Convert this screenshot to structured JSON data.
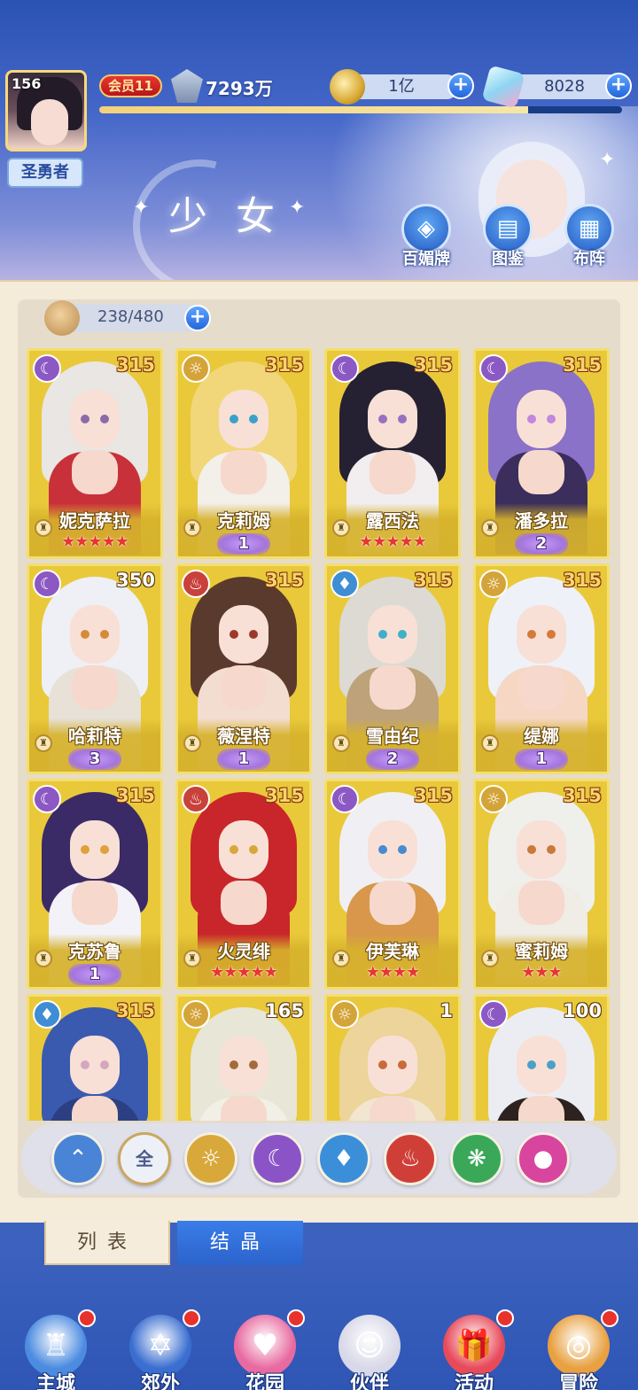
{
  "header": {
    "player_level": "156",
    "player_title": "圣勇者",
    "vip": "会员11",
    "power": "7293万",
    "exp_progress": 0.82,
    "gold": "1亿",
    "gems": "8028",
    "page_title": "少女",
    "buttons": [
      {
        "label": "百媚牌",
        "icon": "card-deck-icon"
      },
      {
        "label": "图鉴",
        "icon": "book-icon"
      },
      {
        "label": "布阵",
        "icon": "formation-grid-icon"
      }
    ]
  },
  "roster": {
    "capacity": "238/480",
    "cards": [
      {
        "name": "妮克萨拉",
        "level": "315",
        "element": "moon",
        "stars": 5,
        "awaken": null
      },
      {
        "name": "克莉姆",
        "level": "315",
        "element": "sun",
        "stars": 0,
        "awaken": "1"
      },
      {
        "name": "露西法",
        "level": "315",
        "element": "moon",
        "stars": 5,
        "awaken": null
      },
      {
        "name": "潘多拉",
        "level": "315",
        "element": "moon",
        "stars": 0,
        "awaken": "2"
      },
      {
        "name": "哈莉特",
        "level": "350",
        "element": "moon",
        "stars": 0,
        "awaken": "3"
      },
      {
        "name": "薇涅特",
        "level": "315",
        "element": "fire",
        "stars": 0,
        "awaken": "1"
      },
      {
        "name": "雪由纪",
        "level": "315",
        "element": "water",
        "stars": 0,
        "awaken": "2"
      },
      {
        "name": "缇娜",
        "level": "315",
        "element": "sun",
        "stars": 0,
        "awaken": "1"
      },
      {
        "name": "克苏鲁",
        "level": "315",
        "element": "moon",
        "stars": 0,
        "awaken": "1"
      },
      {
        "name": "火灵绯",
        "level": "315",
        "element": "fire",
        "stars": 5,
        "awaken": null
      },
      {
        "name": "伊芙琳",
        "level": "315",
        "element": "moon",
        "stars": 4,
        "awaken": null
      },
      {
        "name": "蜜莉姆",
        "level": "315",
        "element": "sun",
        "stars": 3,
        "awaken": null
      },
      {
        "name": "",
        "level": "315",
        "element": "water",
        "stars": 0,
        "awaken": null
      },
      {
        "name": "",
        "level": "165",
        "element": "sun",
        "stars": 0,
        "awaken": null
      },
      {
        "name": "",
        "level": "1",
        "element": "sun",
        "stars": 0,
        "awaken": null
      },
      {
        "name": "",
        "level": "100",
        "element": "moon",
        "stars": 0,
        "awaken": null
      }
    ]
  },
  "filters": [
    {
      "label": "",
      "icon": "sort-up-icon",
      "color": "#4a84d6"
    },
    {
      "label": "全",
      "icon": "all-icon",
      "color": "#eef0f8"
    },
    {
      "label": "",
      "icon": "sun-element-icon",
      "color": "#d8a83a"
    },
    {
      "label": "",
      "icon": "moon-element-icon",
      "color": "#8a54c6"
    },
    {
      "label": "",
      "icon": "water-element-icon",
      "color": "#3b8fd8"
    },
    {
      "label": "",
      "icon": "fire-element-icon",
      "color": "#cf3f38"
    },
    {
      "label": "",
      "icon": "wind-element-icon",
      "color": "#3aa858"
    },
    {
      "label": "",
      "icon": "heart-element-icon",
      "color": "#d8459e"
    }
  ],
  "tabs": {
    "list": "列表",
    "crystal": "结晶"
  },
  "nav": [
    {
      "label": "主城",
      "icon": "castle-icon",
      "badge": true
    },
    {
      "label": "郊外",
      "icon": "magic-circle-icon",
      "badge": true
    },
    {
      "label": "花园",
      "icon": "heart-garden-icon",
      "badge": true
    },
    {
      "label": "伙伴",
      "icon": "companion-portrait-icon",
      "badge": false
    },
    {
      "label": "活动",
      "icon": "gift-box-icon",
      "badge": true
    },
    {
      "label": "冒险",
      "icon": "compass-icon",
      "badge": true
    }
  ]
}
